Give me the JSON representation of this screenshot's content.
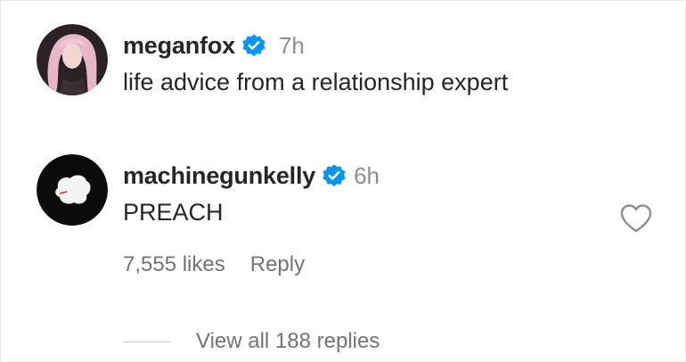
{
  "comments": [
    {
      "username": "meganfox",
      "verified": true,
      "time": "7h",
      "text": "life advice from a relationship expert",
      "avatar_icon": "avatar-pink-hair"
    },
    {
      "username": "machinegunkelly",
      "verified": true,
      "time": "6h",
      "text": "PREACH",
      "likes": "7,555 likes",
      "reply_label": "Reply",
      "avatar_icon": "avatar-white-blob-on-black",
      "like_icon": "heart-outline-icon"
    }
  ],
  "view_replies_label": "View all 188 replies",
  "colors": {
    "verified_blue": "#0095f6",
    "text_primary": "#262626",
    "text_secondary": "#8e8e8e",
    "text_meta": "#737373"
  }
}
